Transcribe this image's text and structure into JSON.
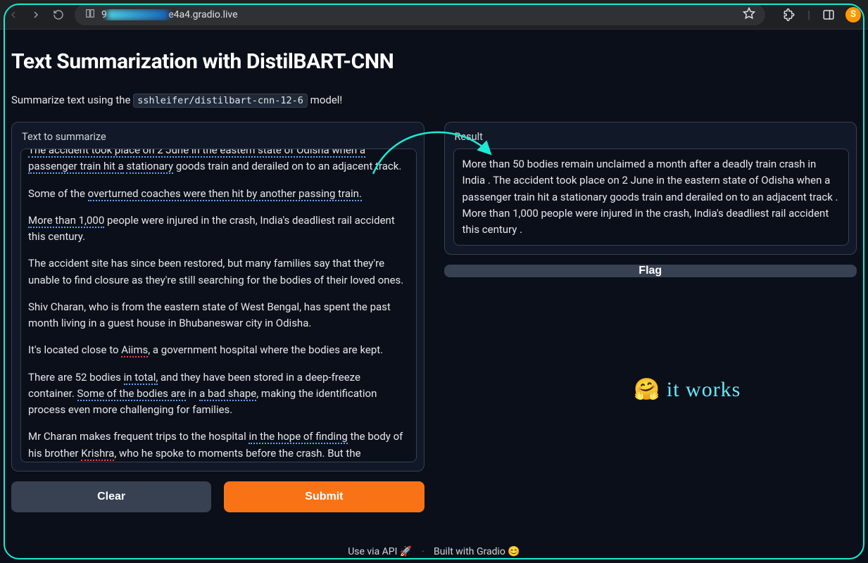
{
  "browser": {
    "url_visible_prefix": "9",
    "url_visible_suffix": "e4a4.gradio.live",
    "profile_letter": "S"
  },
  "header": {
    "title": "Text Summarization with DistilBART-CNN",
    "subtitle_prefix": "Summarize text using the ",
    "model_code": "sshleifer/distilbart-cnn-12-6",
    "subtitle_suffix": " model!"
  },
  "input": {
    "label": "Text to summarize",
    "paragraphs": [
      "The accident took place on 2 June in the eastern state of Odisha when a passenger train hit a stationary goods train and derailed on to an adjacent track.",
      "Some of the overturned coaches were then hit by another passing train.",
      "More than 1,000 people were injured in the crash, India's deadliest rail accident this century.",
      "The accident site has since been restored, but many families say that they're unable to find closure as they're still searching for the bodies of their loved ones.",
      "Shiv Charan, who is from the eastern state of West Bengal, has spent the past month living in a guest house in Bhubaneswar city in Odisha.",
      "It's located close to Aiims, a government hospital where the bodies are kept.",
      "There are 52 bodies in total, and they have been stored in a deep-freeze container. Some of the bodies are in a bad shape, making the identification process even more challenging for families.",
      "Mr Charan makes frequent trips to the hospital in the hope of finding the body of his brother Krishra, who he spoke to moments before the crash. But the agonising wait stretches on endlessly."
    ]
  },
  "output": {
    "label": "Result",
    "text": " More than 50 bodies remain unclaimed a month after a deadly train crash in India . The accident took place on 2 June in the eastern state of Odisha when a passenger train hit a stationary goods train and derailed on to an adjacent track . More than 1,000 people were injured in the crash, India's deadliest rail accident this century ."
  },
  "buttons": {
    "clear": "Clear",
    "submit": "Submit",
    "flag": "Flag"
  },
  "footer": {
    "api": "Use via API  🚀",
    "built": "Built with Gradio  😊"
  },
  "annotation": {
    "text": "🤗 it works"
  }
}
